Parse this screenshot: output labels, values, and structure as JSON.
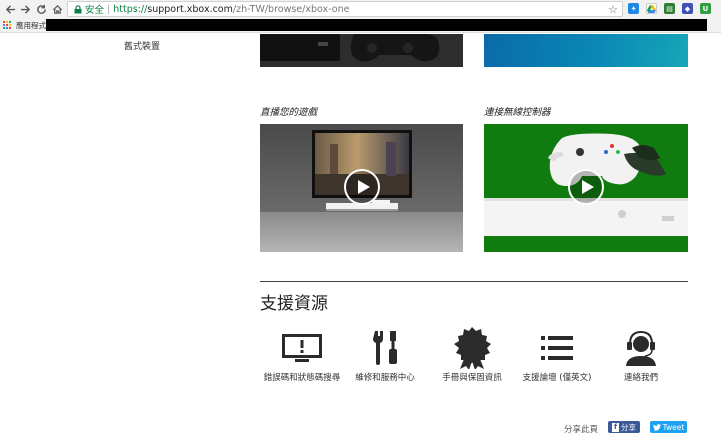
{
  "browser": {
    "secure_label": "安全",
    "url_protocol": "https://",
    "url_host": "support.xbox.com",
    "url_path": "/zh-TW/browse/xbox-one"
  },
  "bookmarks": {
    "apps_label": "應用程式"
  },
  "sidebar": {
    "item_label": "舊式裝置"
  },
  "videos": [
    {
      "title": "直播您的遊戲"
    },
    {
      "title": "連接無線控制器"
    }
  ],
  "support": {
    "title": "支援資源",
    "items": [
      {
        "label": "錯誤碼和狀態碼搜尋",
        "icon": "monitor-alert-icon"
      },
      {
        "label": "維修和服務中心",
        "icon": "tools-icon"
      },
      {
        "label": "手冊與保固資訊",
        "icon": "badge-icon"
      },
      {
        "label": "支援論壇 (僅英文)",
        "icon": "list-icon"
      },
      {
        "label": "連絡我們",
        "icon": "headset-agent-icon"
      }
    ]
  },
  "share": {
    "label": "分享此頁",
    "facebook_label": "分享",
    "twitter_label": "Tweet"
  },
  "colors": {
    "xbox_green": "#0f7c10",
    "secure_green": "#0b8043",
    "facebook_blue": "#3b5998",
    "twitter_blue": "#1da1f2"
  }
}
